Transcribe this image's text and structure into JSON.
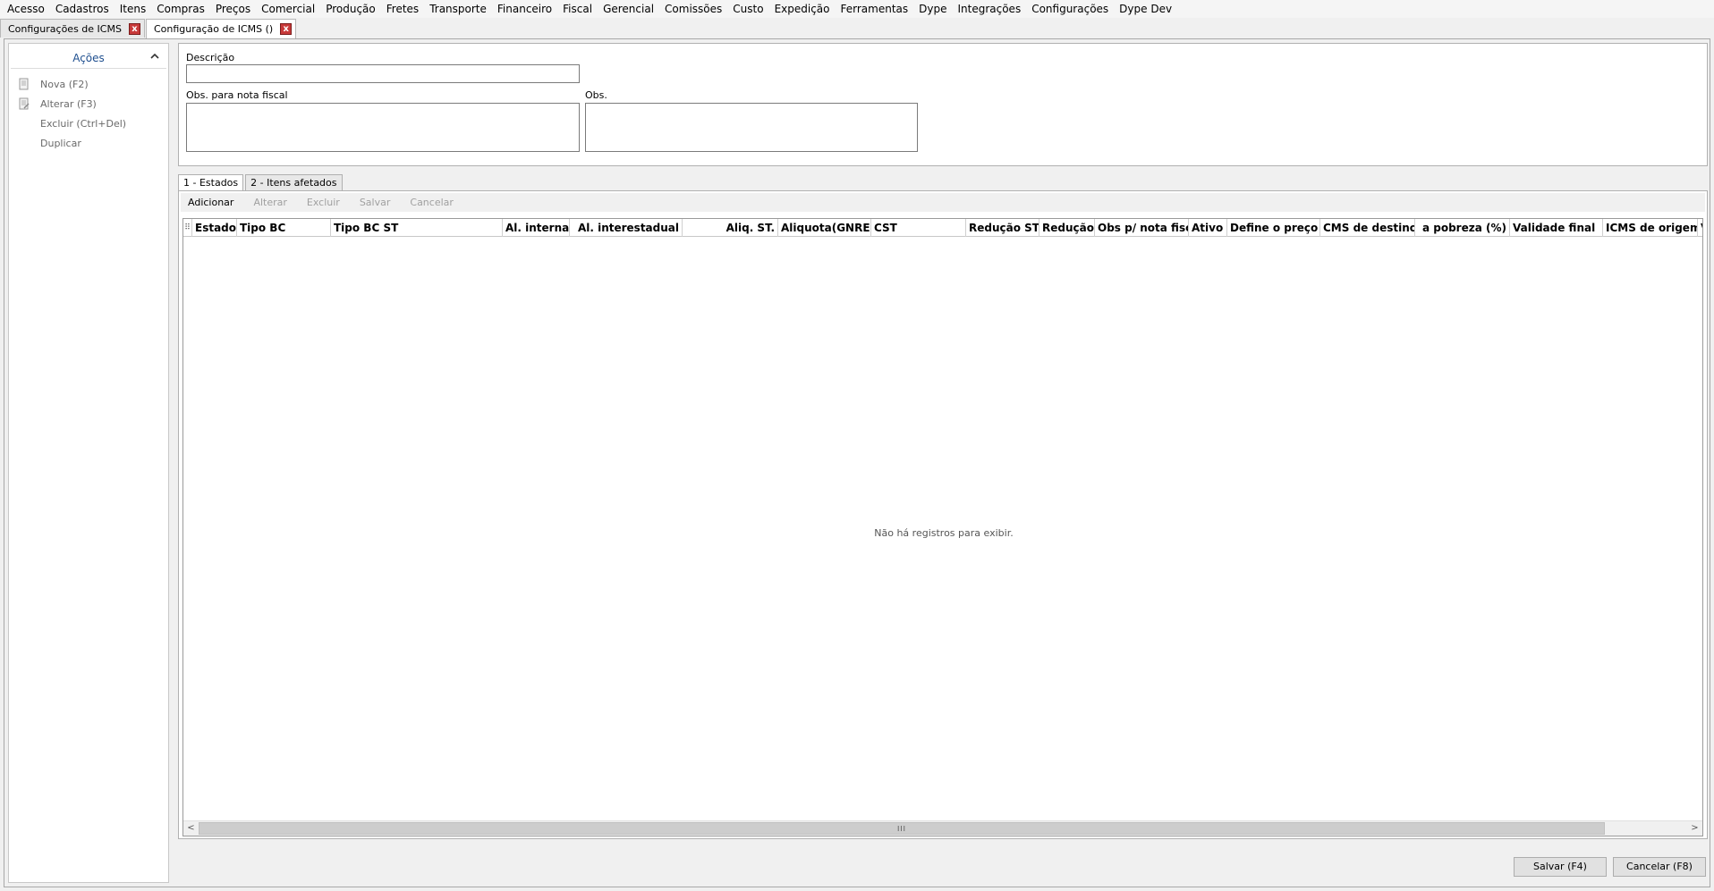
{
  "menu": [
    "Acesso",
    "Cadastros",
    "Itens",
    "Compras",
    "Preços",
    "Comercial",
    "Produção",
    "Fretes",
    "Transporte",
    "Financeiro",
    "Fiscal",
    "Gerencial",
    "Comissões",
    "Custo",
    "Expedição",
    "Ferramentas",
    "Dype",
    "Integrações",
    "Configurações",
    "Dype Dev"
  ],
  "doc_tabs": [
    {
      "label": "Configurações de ICMS",
      "close": "x"
    },
    {
      "label": "Configuração de ICMS ()",
      "close": "x"
    }
  ],
  "sidebar": {
    "title": "Ações",
    "items": [
      {
        "label": "Nova (F2)",
        "icon": "new-document-icon"
      },
      {
        "label": "Alterar (F3)",
        "icon": "edit-document-icon"
      },
      {
        "label": "Excluir (Ctrl+Del)",
        "icon": ""
      },
      {
        "label": "Duplicar",
        "icon": ""
      }
    ]
  },
  "form": {
    "descricao_label": "Descrição",
    "descricao_value": "",
    "obs_nf_label": "Obs. para nota fiscal",
    "obs_nf_value": "",
    "obs_label": "Obs.",
    "obs_value": ""
  },
  "inner_tabs": [
    "1 - Estados",
    "2 - Itens afetados"
  ],
  "grid_toolbar": [
    "Adicionar",
    "Alterar",
    "Excluir",
    "Salvar",
    "Cancelar"
  ],
  "grid": {
    "selector_glyph": "⠿",
    "columns": [
      "Estado",
      "Tipo BC",
      "Tipo BC ST",
      "Al. interna",
      "Al. interestadual",
      "Aliq. ST.",
      "Aliquota(GNRE)",
      "CST",
      "Redução ST",
      "Redução",
      "Obs p/ nota fisc",
      "Ativo",
      "Define o preço",
      "CMS de destino",
      "a pobreza (%)",
      "Validade final",
      "ICMS de origem",
      "V"
    ],
    "empty_message": "Não há registros para exibir."
  },
  "scrollbar": {
    "left": "<",
    "right": ">",
    "grip": "III"
  },
  "buttons": {
    "save": "Salvar (F4)",
    "cancel": "Cancelar (F8)"
  }
}
